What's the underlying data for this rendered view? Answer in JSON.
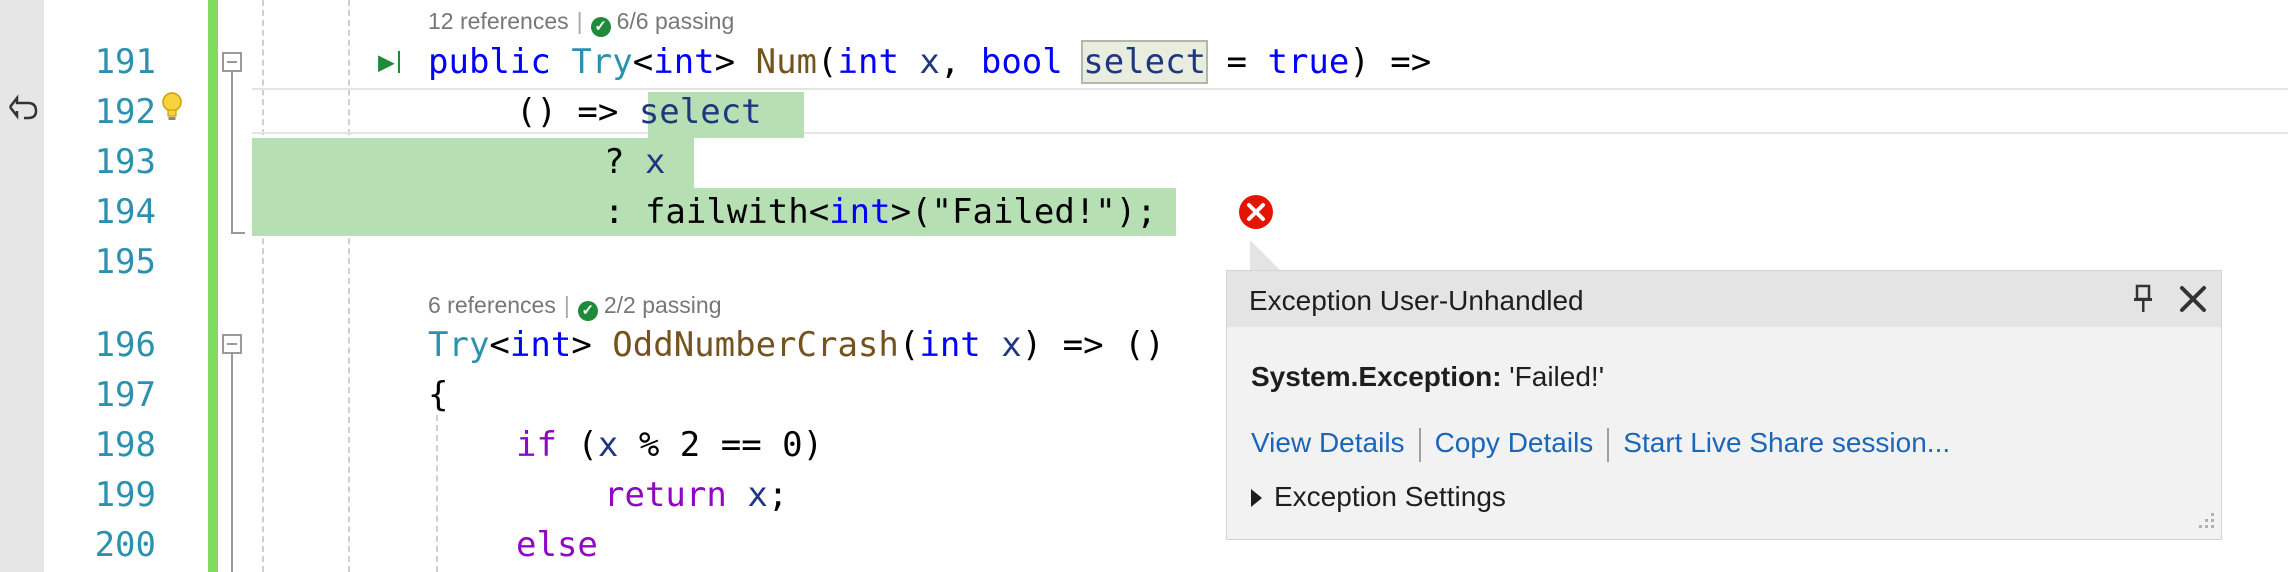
{
  "gutter": {
    "line_numbers": [
      "191",
      "192",
      "193",
      "194",
      "195",
      "196",
      "197",
      "198",
      "199",
      "200"
    ]
  },
  "codelens": [
    {
      "references": "12 references",
      "tests": "6/6 passing"
    },
    {
      "references": "6 references",
      "tests": "2/2 passing"
    }
  ],
  "code": {
    "l191": {
      "t1": "public",
      "t2": " ",
      "t3": "Try",
      "t4": "<",
      "t5": "int",
      "t6": "> ",
      "t7": "Num",
      "t8": "(",
      "t9": "int",
      "t10": " ",
      "t11": "x",
      "t12": ", ",
      "t13": "bool",
      "t14": " ",
      "t15": "select",
      "t16": " = ",
      "t17": "true",
      "t18": ") =>"
    },
    "l192": {
      "t1": "() => ",
      "t2": "select"
    },
    "l193": {
      "t1": "? ",
      "t2": "x"
    },
    "l194": {
      "t1": ": failwith<",
      "t2": "int",
      "t3": ">(\"Failed!\");"
    },
    "l196": {
      "t1": "Try",
      "t2": "<",
      "t3": "int",
      "t4": "> ",
      "t5": "OddNumberCrash",
      "t6": "(",
      "t7": "int",
      "t8": " ",
      "t9": "x",
      "t10": ") => ()"
    },
    "l197": {
      "t1": "{"
    },
    "l198": {
      "t1": "if",
      "t2": " (",
      "t3": "x",
      "t4": " % 2 == 0)"
    },
    "l199": {
      "t1": "return",
      "t2": " ",
      "t3": "x",
      "t4": ";"
    },
    "l200": {
      "t1": "else"
    }
  },
  "exception_popup": {
    "title": "Exception User-Unhandled",
    "exception_type": "System.Exception:",
    "message": " 'Failed!'",
    "links": [
      "View Details",
      "Copy Details",
      "Start Live Share session..."
    ],
    "settings_label": "Exception Settings"
  },
  "colors": {
    "line_number": "#2b91af",
    "keyword": "#0000ff",
    "type": "#2b91af",
    "method": "#74531f",
    "parameter": "#1f377f",
    "control": "#8f08c4",
    "highlight": "#b6e0b4",
    "change_bar": "#7fdc60",
    "error": "#e51400",
    "link": "#1a66b8"
  },
  "icons": [
    "run-to-cursor-icon",
    "lightbulb-icon",
    "error-icon",
    "pin-icon",
    "close-icon",
    "passing-check-icon",
    "fold-toggle-icon"
  ]
}
